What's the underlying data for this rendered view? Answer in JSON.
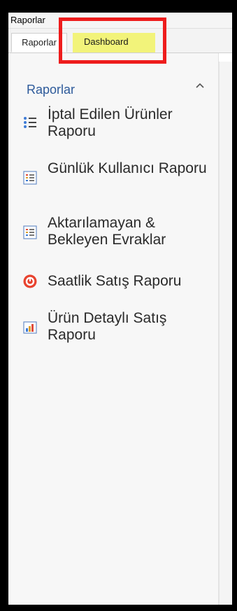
{
  "window": {
    "title": "Raporlar"
  },
  "tabs": {
    "raporlar": "Raporlar",
    "dashboard": "Dashboard"
  },
  "group": {
    "title": "Raporlar"
  },
  "items": [
    {
      "label": "İptal Edilen Ürünler Raporu",
      "icon": "list-bullets-icon"
    },
    {
      "label": "Günlük Kullanıcı Raporu",
      "icon": "report-list-icon"
    },
    {
      "label": "Aktarılamayan & Bekleyen Evraklar",
      "icon": "report-list-icon"
    },
    {
      "label": "Saatlik Satış Raporu",
      "icon": "clock-circle-icon"
    },
    {
      "label": "Ürün Detaylı Satış Raporu",
      "icon": "bar-chart-icon"
    }
  ],
  "colors": {
    "group_header": "#2d5a9a",
    "highlight_box": "#ee1c1c",
    "dashboard_tab_highlight": "#f2f37a",
    "clock_icon": "#e8432f"
  }
}
